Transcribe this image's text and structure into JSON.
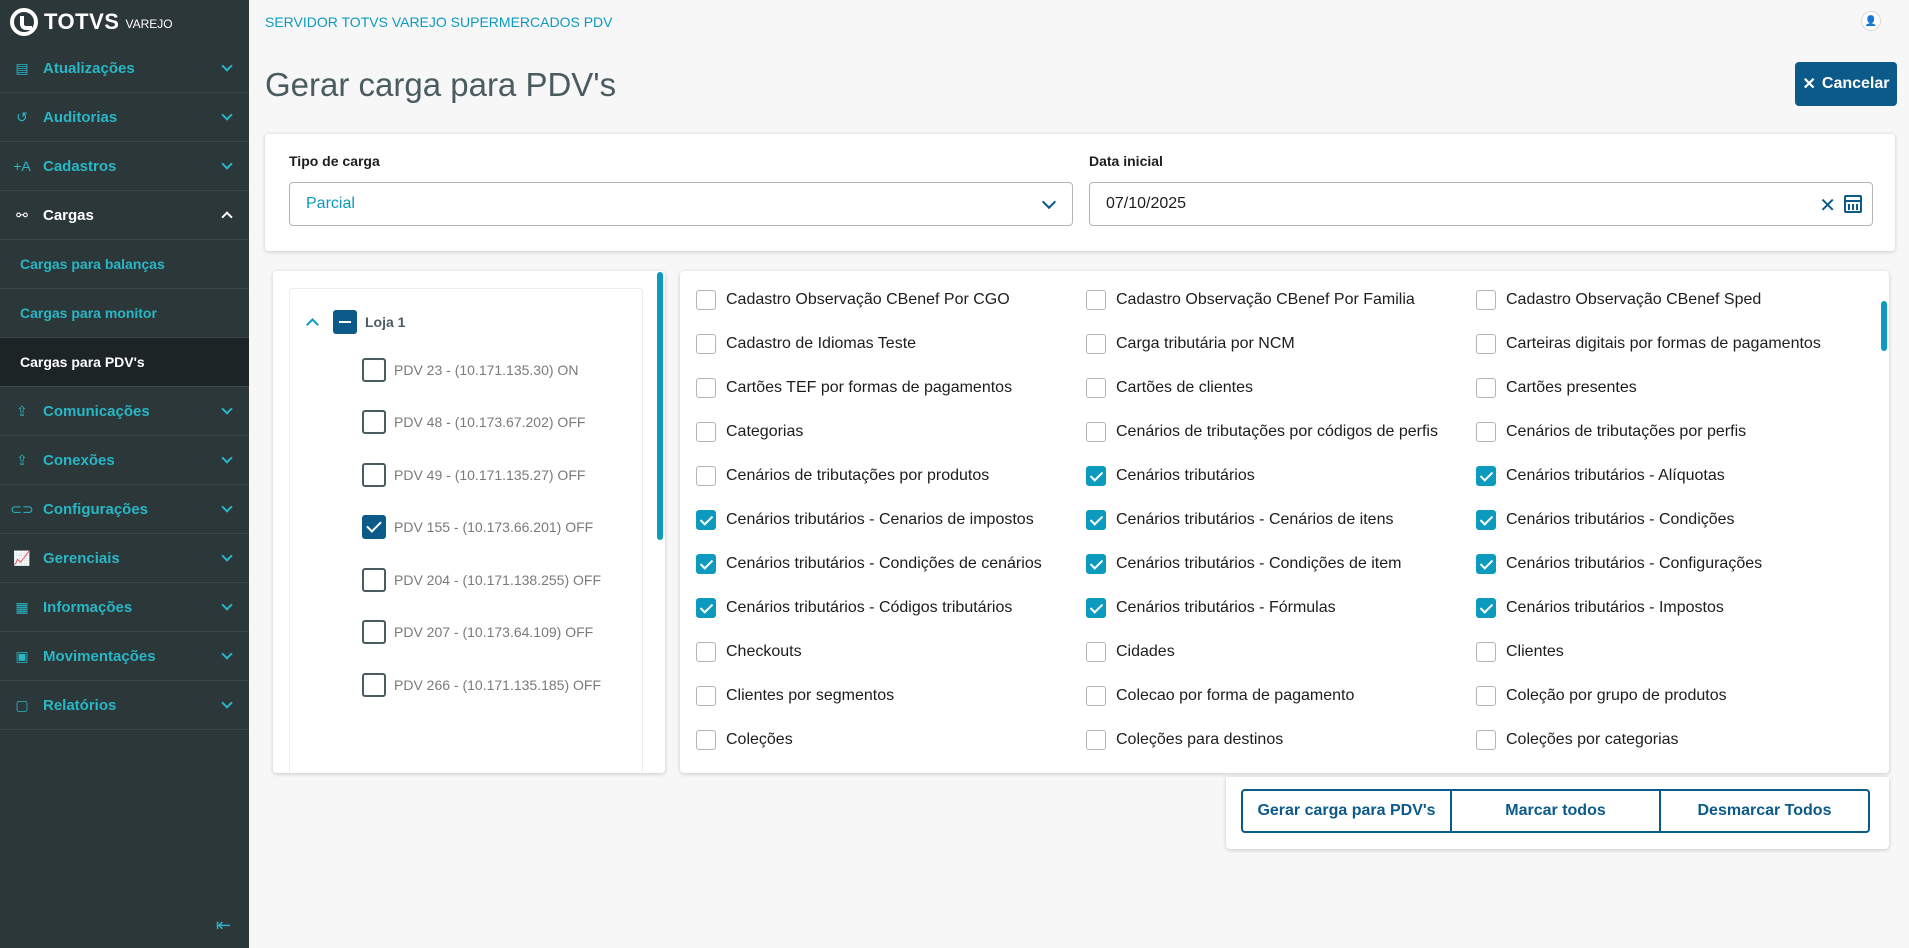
{
  "brand": {
    "name": "TOTVS",
    "sub": "VAREJO"
  },
  "sidebar": {
    "items": [
      {
        "label": "Atualizações",
        "icon": "server-icon"
      },
      {
        "label": "Auditorias",
        "icon": "history-icon"
      },
      {
        "label": "Cadastros",
        "icon": "add-user-icon"
      },
      {
        "label": "Cargas",
        "icon": "share-icon",
        "open": true,
        "children": [
          "Cargas para balanças",
          "Cargas para monitor",
          "Cargas para PDV's"
        ]
      },
      {
        "label": "Comunicações",
        "icon": "document-upload-icon"
      },
      {
        "label": "Conexões",
        "icon": "document-upload-icon"
      },
      {
        "label": "Configurações",
        "icon": "link-icon"
      },
      {
        "label": "Gerenciais",
        "icon": "chart-icon"
      },
      {
        "label": "Informações",
        "icon": "building-icon"
      },
      {
        "label": "Movimentações",
        "icon": "clipboard-icon"
      },
      {
        "label": "Relatórios",
        "icon": "document-icon"
      }
    ],
    "active_child": "Cargas para PDV's"
  },
  "header": {
    "server_title": "SERVIDOR TOTVS VAREJO SUPERMERCADOS PDV",
    "page_title": "Gerar carga para PDV's",
    "cancel_label": "Cancelar"
  },
  "filters": {
    "tipo_label": "Tipo de carga",
    "tipo_value": "Parcial",
    "data_label": "Data inicial",
    "data_value": "07/10/2025"
  },
  "tree": {
    "root_label": "Loja 1",
    "pdvs": [
      {
        "label": "PDV 23 - (10.171.135.30) ON",
        "checked": false
      },
      {
        "label": "PDV 48 - (10.173.67.202) OFF",
        "checked": false
      },
      {
        "label": "PDV 49 - (10.171.135.27) OFF",
        "checked": false
      },
      {
        "label": "PDV 155 - (10.173.66.201) OFF",
        "checked": true
      },
      {
        "label": "PDV 204 - (10.171.138.255) OFF",
        "checked": false
      },
      {
        "label": "PDV 207 - (10.173.64.109) OFF",
        "checked": false
      },
      {
        "label": "PDV 266 - (10.171.135.185) OFF",
        "checked": false
      }
    ]
  },
  "options": [
    {
      "label": "Cadastro Observação CBenef Por CGO",
      "checked": false
    },
    {
      "label": "Cadastro Observação CBenef Por Familia",
      "checked": false
    },
    {
      "label": "Cadastro Observação CBenef Sped",
      "checked": false
    },
    {
      "label": "Cadastro de Idiomas Teste",
      "checked": false
    },
    {
      "label": "Carga tributária por NCM",
      "checked": false
    },
    {
      "label": "Carteiras digitais por formas de pagamentos",
      "checked": false
    },
    {
      "label": "Cartões TEF por formas de pagamentos",
      "checked": false
    },
    {
      "label": "Cartões de clientes",
      "checked": false
    },
    {
      "label": "Cartões presentes",
      "checked": false
    },
    {
      "label": "Categorias",
      "checked": false
    },
    {
      "label": "Cenários de tributações por códigos de perfis",
      "checked": false
    },
    {
      "label": "Cenários de tributações por perfis",
      "checked": false
    },
    {
      "label": "Cenários de tributações por produtos",
      "checked": false
    },
    {
      "label": "Cenários tributários",
      "checked": true
    },
    {
      "label": "Cenários tributários - Alíquotas",
      "checked": true
    },
    {
      "label": "Cenários tributários - Cenarios de impostos",
      "checked": true
    },
    {
      "label": "Cenários tributários - Cenários de itens",
      "checked": true
    },
    {
      "label": "Cenários tributários - Condições",
      "checked": true
    },
    {
      "label": "Cenários tributários - Condições de cenários",
      "checked": true
    },
    {
      "label": "Cenários tributários - Condições de item",
      "checked": true
    },
    {
      "label": "Cenários tributários - Configurações",
      "checked": true
    },
    {
      "label": "Cenários tributários - Códigos tributários",
      "checked": true
    },
    {
      "label": "Cenários tributários - Fórmulas",
      "checked": true
    },
    {
      "label": "Cenários tributários - Impostos",
      "checked": true
    },
    {
      "label": "Checkouts",
      "checked": false
    },
    {
      "label": "Cidades",
      "checked": false
    },
    {
      "label": "Clientes",
      "checked": false
    },
    {
      "label": "Clientes por segmentos",
      "checked": false
    },
    {
      "label": "Colecao por forma de pagamento",
      "checked": false
    },
    {
      "label": "Coleção por grupo de produtos",
      "checked": false
    },
    {
      "label": "Coleções",
      "checked": false
    },
    {
      "label": "Coleções para destinos",
      "checked": false
    },
    {
      "label": "Coleções por categorias",
      "checked": false
    }
  ],
  "actions": {
    "generate_label": "Gerar carga para PDV's",
    "check_all_label": "Marcar todos",
    "uncheck_all_label": "Desmarcar Todos"
  },
  "colors": {
    "sidebar_bg": "#2c3739",
    "accent": "#0c9abe",
    "primary": "#0b5a8a"
  }
}
